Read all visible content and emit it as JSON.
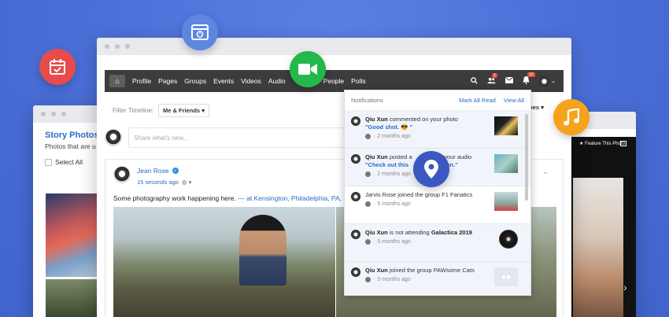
{
  "nav": {
    "items": [
      "Profile",
      "Pages",
      "Groups",
      "Events",
      "Videos",
      "Audio",
      "People",
      "Polls"
    ],
    "friend_requests_badge": "2",
    "notifications_badge": "10"
  },
  "filter": {
    "label": "Filter Timeline:",
    "value": "Me & Friends",
    "types_label": "ypes"
  },
  "composer": {
    "placeholder": "Share what's new..."
  },
  "post": {
    "author": "Jean Rose",
    "time": "15 seconds ago",
    "text": "Some photography work happening here.",
    "location": "— at Kensington, Philadelphia, PA, USA"
  },
  "notifications": {
    "title": "Notifications",
    "mark_all_read": "Mark All Read",
    "view_all": "View All",
    "items": [
      {
        "name": "Qiu Xun",
        "action": "commented on your photo",
        "quote": "\"Good shot. 😎 \"",
        "time": "2 months ago"
      },
      {
        "name": "Qiu Xun",
        "action": "posted a",
        "action2": "on your audio",
        "quote": "\"Check out this",
        "quote2": "version.\"",
        "time": "2 months ago"
      },
      {
        "name": "Jarvis Rose",
        "action": "joined the group F1 Fanatics",
        "time": "5 months ago"
      },
      {
        "name": "Qiu Xun",
        "action": "is not attending",
        "bold": "Galactica 2019",
        "time": "5 months ago"
      },
      {
        "name": "Qiu Xun",
        "action": "joined the group PAWsome Cats",
        "time": "5 months ago"
      }
    ]
  },
  "left_window": {
    "title": "Story Photos",
    "subtitle": "Photos that are u",
    "select_all": "Select All"
  },
  "right_window": {
    "feature_label": "Feature This Photo"
  },
  "colors": {
    "background": "#4a6ed6",
    "calendar_icon": "#e84b4b",
    "video_icon": "#22b84a",
    "music_icon": "#f7a21b",
    "location_icon": "#3b57c0",
    "browser_icon": "#5e86e0",
    "link": "#2b6cc4",
    "navbar": "#3c3c3c"
  }
}
